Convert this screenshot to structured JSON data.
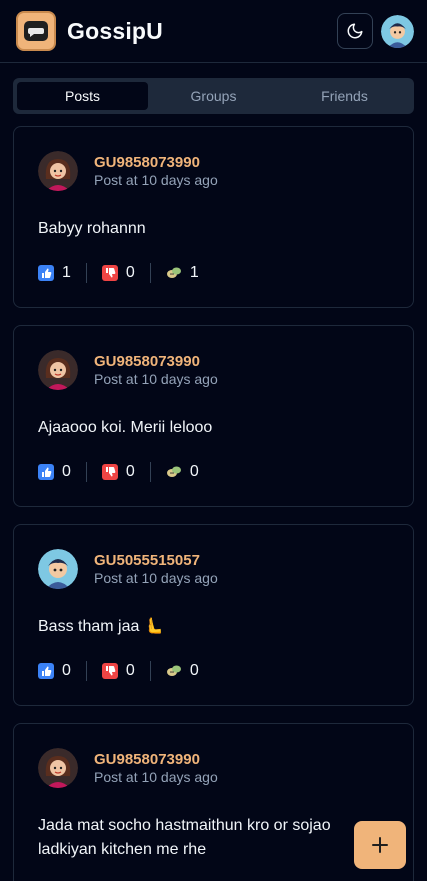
{
  "app": {
    "title": "GossipU",
    "accent": "#f0b47a",
    "background": "#020617"
  },
  "header": {
    "theme_icon": "moon-icon",
    "logo_icon": "chat-bubble-icon"
  },
  "tabs": [
    {
      "label": "Posts",
      "active": true
    },
    {
      "label": "Groups",
      "active": false
    },
    {
      "label": "Friends",
      "active": false
    }
  ],
  "posts": [
    {
      "user": "GU9858073990",
      "time": "Post at 10 days ago",
      "content": "Babyy rohannn",
      "likes": "1",
      "dislikes": "0",
      "comments": "1"
    },
    {
      "user": "GU9858073990",
      "time": "Post at 10 days ago",
      "content": "Ajaaooo koi. Merii lelooo",
      "likes": "0",
      "dislikes": "0",
      "comments": "0"
    },
    {
      "user": "GU5055515057",
      "time": "Post at 10 days ago",
      "content": "Bass tham jaa 🫷",
      "likes": "0",
      "dislikes": "0",
      "comments": "0"
    },
    {
      "user": "GU9858073990",
      "time": "Post at 10 days ago",
      "content": "Jada mat socho hastmaithun kro or sojao ladkiyan kitchen me rhe",
      "likes": "",
      "dislikes": "",
      "comments": ""
    }
  ],
  "fab": {
    "icon": "plus-icon"
  }
}
